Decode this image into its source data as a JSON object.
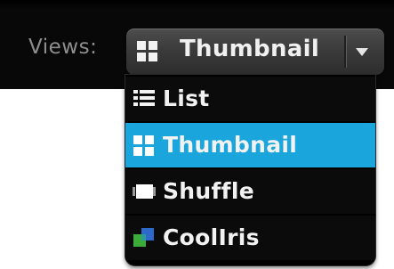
{
  "views": {
    "label": "Views:",
    "selected": "Thumbnail",
    "options": [
      {
        "label": "List",
        "icon": "list-icon",
        "selected": false
      },
      {
        "label": "Thumbnail",
        "icon": "thumbnail-grid-icon",
        "selected": true
      },
      {
        "label": "Shuffle",
        "icon": "shuffle-icon",
        "selected": false
      },
      {
        "label": "CoolIris",
        "icon": "cooliris-icon",
        "selected": false
      }
    ]
  },
  "colors": {
    "toolbar_bg": "#080808",
    "dropdown_bg": "#3b3b3b",
    "selected_bg": "#1aa6dc",
    "text": "#f2f2f2",
    "label_text": "#8e8e8e"
  }
}
